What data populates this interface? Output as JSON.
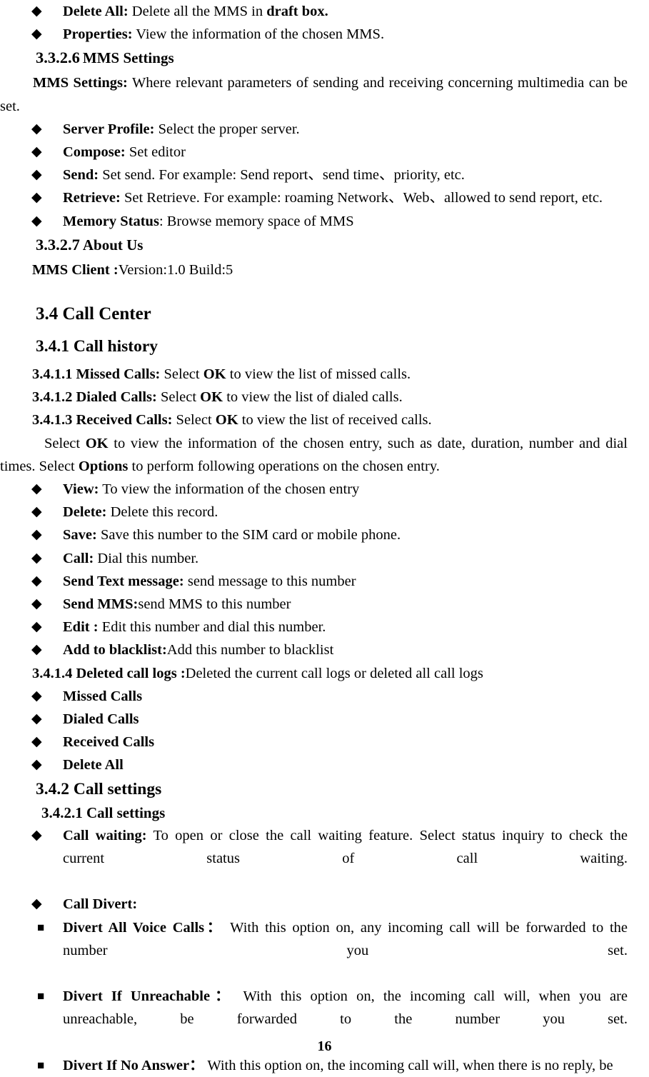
{
  "document": {
    "page_number": "16",
    "bullet_diamond": "◆",
    "bullet_square": "■"
  },
  "mms_options": [
    {
      "label": "Delete All:",
      "text": " Delete all the MMS in ",
      "bold_tail": "draft box."
    },
    {
      "label": "Properties:",
      "text": " View the information of the chosen MMS."
    }
  ],
  "mms_settings": {
    "heading_number": "3.3.2.6",
    "heading_title": "MMS Settings",
    "intro_label": "MMS Settings:",
    "intro_text": " Where relevant parameters of sending and receiving concerning multimedia can be set.",
    "items": [
      {
        "label": "Server Profile:",
        "text": " Select the proper server."
      },
      {
        "label": "Compose:",
        "text": " Set editor"
      },
      {
        "label": "Send:",
        "text": " Set send. For example: Send report、send time、priority, etc."
      },
      {
        "label": "Retrieve:",
        "text": " Set Retrieve. For example: roaming Network、Web、allowed to send report, etc."
      },
      {
        "label": "Memory Status",
        "text": ": Browse memory space of MMS"
      }
    ]
  },
  "about_us": {
    "heading_number": "3.3.2.7",
    "heading_title": "About Us",
    "client_label": "MMS Client :",
    "client_value": "Version:1.0    Build:5"
  },
  "call_center": {
    "heading": "3.4 Call Center",
    "call_history": {
      "heading": "3.4.1 Call history",
      "entries": [
        {
          "number": "3.4.1.1 Missed Calls:",
          "pre": " Select ",
          "key": "OK",
          "post": " to view the list of missed calls."
        },
        {
          "number": "3.4.1.2 Dialed Calls:",
          "pre": " Select ",
          "key": "OK",
          "post": " to view the list of dialed calls."
        },
        {
          "number": "3.4.1.3 Received Calls:",
          "pre": " Select ",
          "key": "OK",
          "post": " to view the list of received calls."
        }
      ],
      "paragraph": {
        "p1": "Select ",
        "k1": "OK",
        "p2": " to view the information of the chosen entry, such as date, duration, number and dial times. Select ",
        "k2": "Options",
        "p3": " to perform following operations on the chosen entry."
      },
      "options": [
        {
          "label": "View:",
          "text": " To view the information of the chosen entry"
        },
        {
          "label": "Delete:",
          "text": " Delete this record."
        },
        {
          "label": "Save:",
          "text": " Save this number to the SIM card or mobile phone."
        },
        {
          "label": "Call:",
          "text": " Dial this number."
        },
        {
          "label": "Send Text message:",
          "text": " send message to this number"
        },
        {
          "label": "Send MMS:",
          "text": "send MMS to this number"
        },
        {
          "label": "Edit :",
          "text": " Edit this number and dial this number."
        },
        {
          "label": "Add to blacklist:",
          "text": "Add this number to blacklist"
        }
      ],
      "deleted_logs": {
        "number_label": "3.4.1.4 Deleted call logs :",
        "text": "Deleted the current call logs or deleted all call logs",
        "items": [
          {
            "label": "Missed Calls",
            "text": ""
          },
          {
            "label": "Dialed Calls",
            "text": ""
          },
          {
            "label": "Received Calls",
            "text": ""
          },
          {
            "label": "Delete All",
            "text": ""
          }
        ]
      }
    },
    "call_settings": {
      "heading": "3.4.2 Call settings",
      "subheading": "3.4.2.1 Call settings",
      "call_waiting": {
        "label": "Call waiting:",
        "t1": " To open or close the call waiting feature",
        "t2": ". Select status inquiry to check the current status of call waiting."
      },
      "call_divert": {
        "label": "Call Divert:",
        "items": [
          {
            "label": "Divert All Voice Calls",
            "colon": "：",
            "text": " With this option on, any incoming call will be forwarded to the number you set."
          },
          {
            "label": "Divert If Unreachable",
            "colon": "：",
            "text": " With this option on, the incoming call will, when you are unreachable, be forwarded to the number you set."
          },
          {
            "label": "Divert If No Answer",
            "colon": "：",
            "text": " With this option on, the incoming call will, when there is no reply, be"
          }
        ]
      }
    }
  }
}
